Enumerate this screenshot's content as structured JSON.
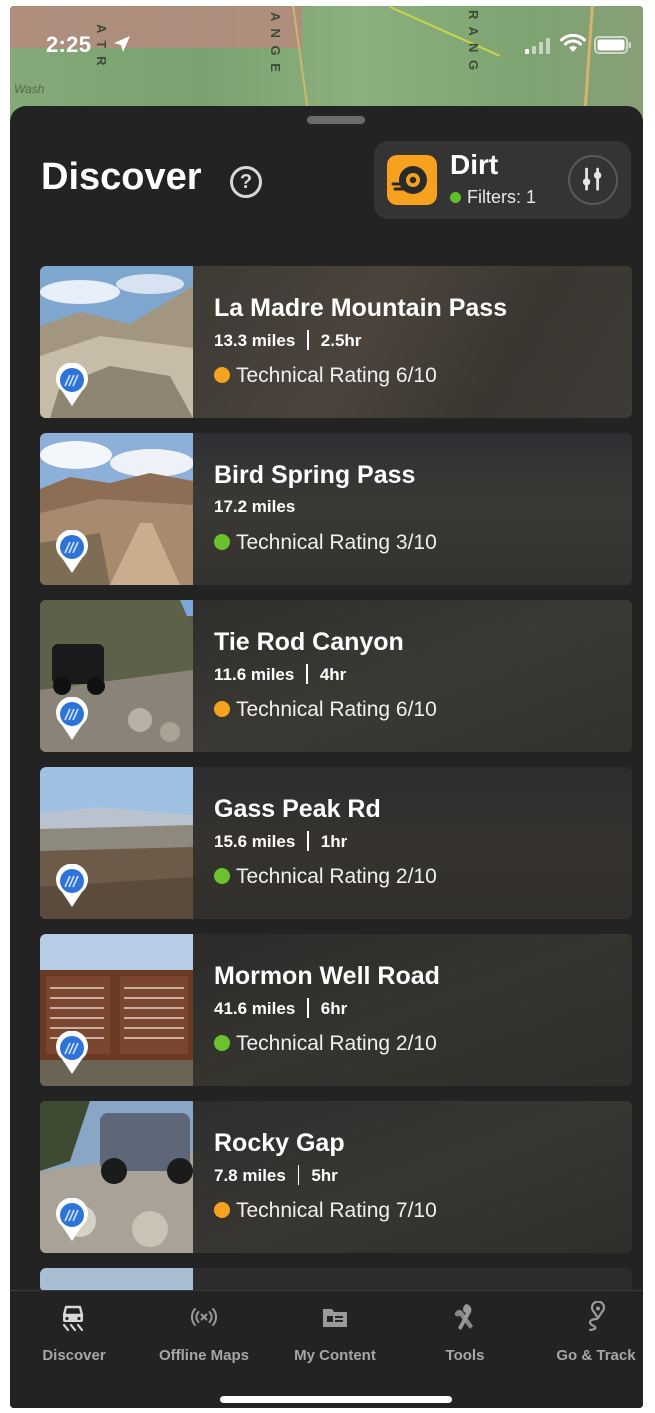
{
  "status": {
    "time": "2:25"
  },
  "map": {
    "label_left": "A T R",
    "label_mid": "A N G E",
    "label_right": "R A N G",
    "wash": "Wash"
  },
  "header": {
    "title": "Discover",
    "help": "?"
  },
  "mode": {
    "name": "Dirt",
    "filters": "Filters: 1",
    "icon": "tire-icon"
  },
  "trails": [
    {
      "name": "La Madre Mountain Pass",
      "miles": "13.3 miles",
      "duration": "2.5hr",
      "rating": "Technical Rating 6/10",
      "rating_color": "#f5a21f"
    },
    {
      "name": "Bird Spring Pass",
      "miles": "17.2 miles",
      "duration": "",
      "rating": "Technical Rating 3/10",
      "rating_color": "#6cc22e"
    },
    {
      "name": "Tie Rod Canyon",
      "miles": "11.6 miles",
      "duration": "4hr",
      "rating": "Technical Rating 6/10",
      "rating_color": "#f5a21f"
    },
    {
      "name": "Gass Peak Rd",
      "miles": "15.6 miles",
      "duration": "1hr",
      "rating": "Technical Rating 2/10",
      "rating_color": "#6cc22e"
    },
    {
      "name": "Mormon Well Road",
      "miles": "41.6 miles",
      "duration": "6hr",
      "rating": "Technical Rating 2/10",
      "rating_color": "#6cc22e"
    },
    {
      "name": "Rocky Gap",
      "miles": "7.8 miles",
      "duration": "5hr",
      "rating": "Technical Rating 7/10",
      "rating_color": "#f5a21f"
    }
  ],
  "tabs": [
    {
      "label": "Discover",
      "icon": "offroad-vehicle-icon"
    },
    {
      "label": "Offline Maps",
      "icon": "offline-signal-icon"
    },
    {
      "label": "My Content",
      "icon": "folder-icon"
    },
    {
      "label": "Tools",
      "icon": "tools-icon"
    },
    {
      "label": "Go & Track",
      "icon": "route-pin-icon"
    }
  ]
}
